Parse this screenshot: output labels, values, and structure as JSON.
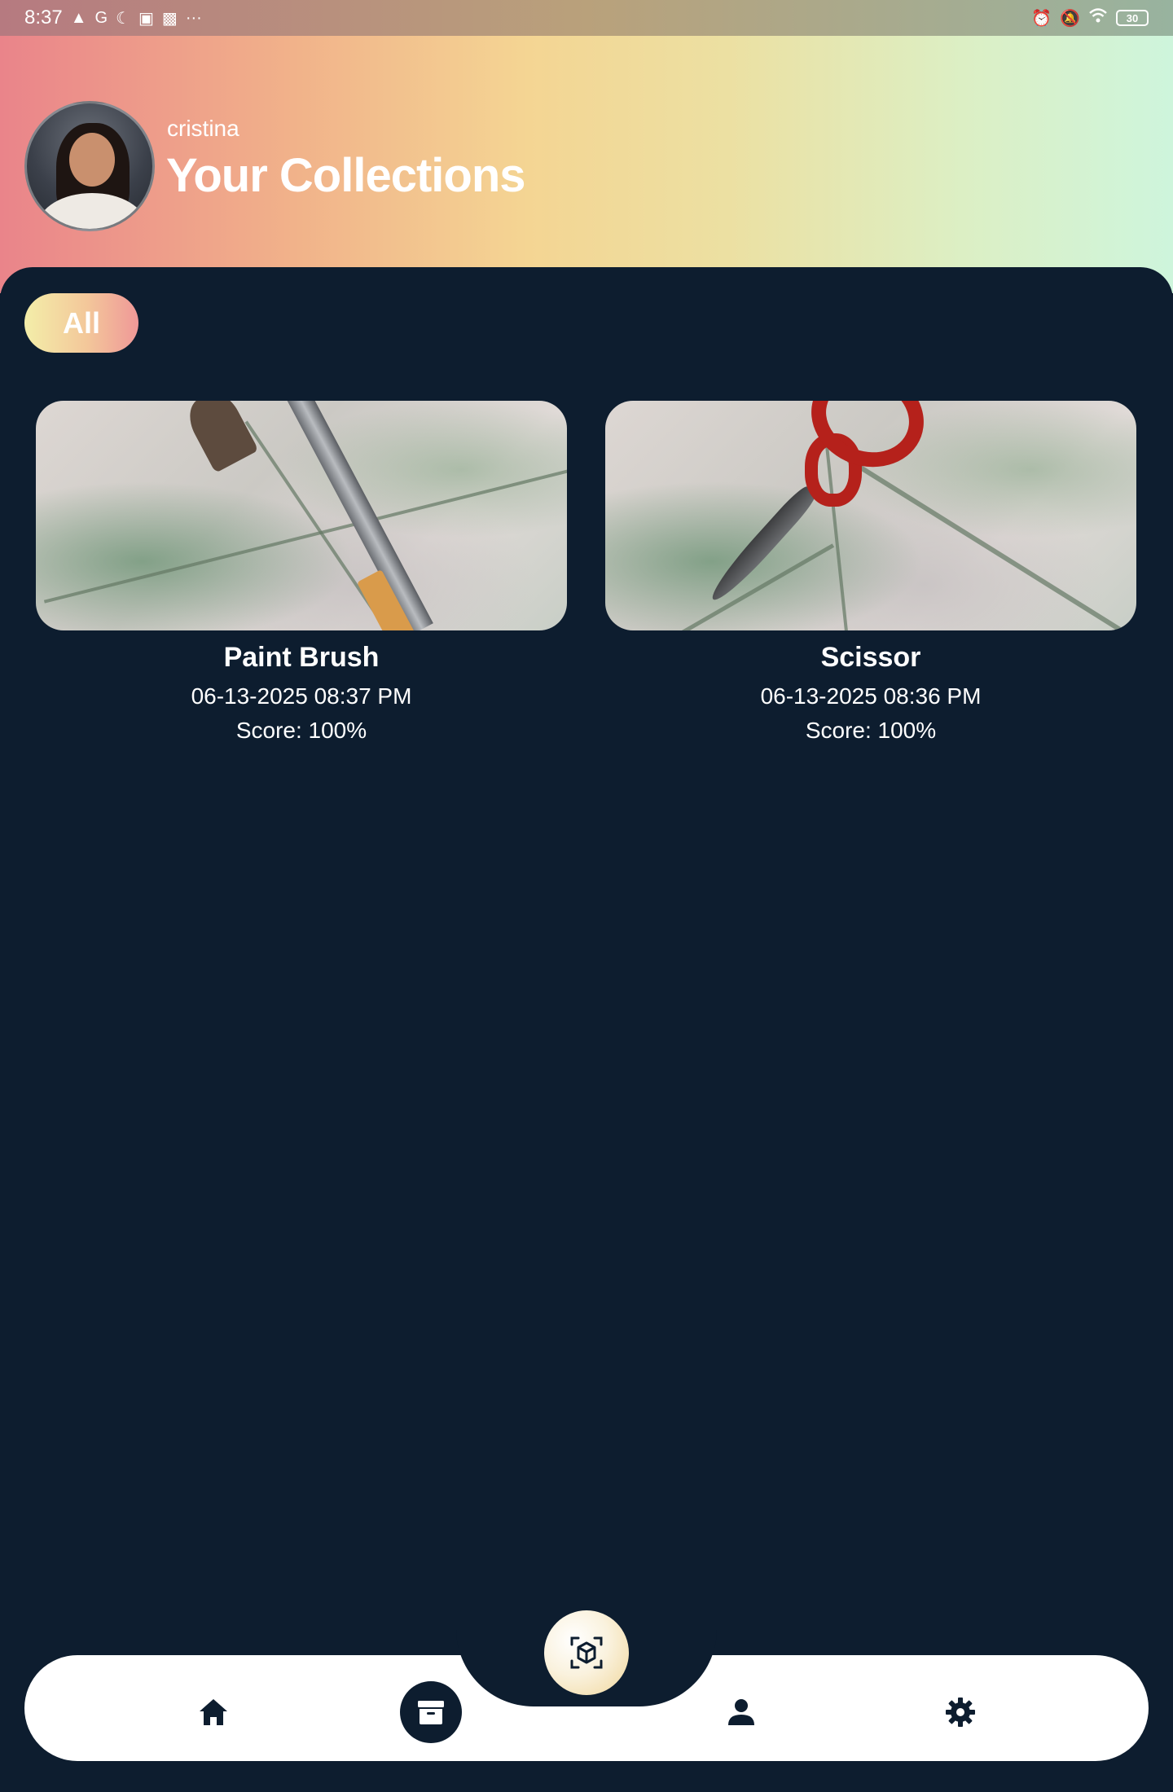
{
  "status_bar": {
    "time": "8:37",
    "battery": "30"
  },
  "header": {
    "username": "cristina",
    "title": "Your Collections"
  },
  "filters": [
    {
      "label": "All",
      "selected": true
    }
  ],
  "collections": [
    {
      "name": "Paint Brush",
      "date": "06-13-2025 08:37 PM",
      "score": "Score: 100%"
    },
    {
      "name": "Scissor",
      "date": "06-13-2025 08:36 PM",
      "score": "Score: 100%"
    }
  ],
  "nav": {
    "items": [
      "home-icon",
      "archive-icon",
      "scan-cube-icon",
      "person-icon",
      "gear-icon"
    ],
    "active": "archive-icon"
  },
  "colors": {
    "background": "#0d1d2f",
    "nav_bg": "#ffffff",
    "accent_gradient": [
      "#ea848a",
      "#f4d593",
      "#cef5dc"
    ]
  }
}
